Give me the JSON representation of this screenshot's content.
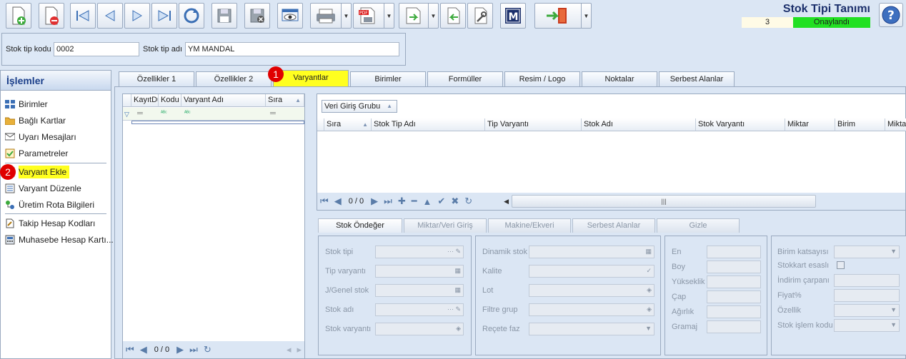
{
  "window": {
    "title": "Stok Tipi Tanımı",
    "record_number": "3",
    "status": "Onaylandı"
  },
  "header": {
    "code_label": "Stok tip kodu",
    "code_value": "0002",
    "name_label": "Stok tip adı",
    "name_value": "YM MANDAL"
  },
  "left_panel": {
    "title": "İşlemler",
    "items": [
      {
        "label": "Birimler",
        "icon": "grid-icon"
      },
      {
        "label": "Bağlı Kartlar",
        "icon": "folder-icon"
      },
      {
        "label": "Uyarı Mesajları",
        "icon": "message-icon"
      },
      {
        "label": "Parametreler",
        "icon": "checklist-icon"
      },
      {
        "label": "Varyant Ekle",
        "icon": "add-variant-icon"
      },
      {
        "label": "Varyant Düzenle",
        "icon": "edit-list-icon"
      },
      {
        "label": "Üretim Rota Bilgileri",
        "icon": "route-icon"
      },
      {
        "label": "Takip Hesap Kodları",
        "icon": "document-icon"
      },
      {
        "label": "Muhasebe Hesap Kartı...",
        "icon": "calculator-icon"
      }
    ]
  },
  "annotations": {
    "badge1": "1",
    "badge2": "2"
  },
  "tabs": [
    "Özellikler 1",
    "Özellikler 2",
    "Varyantlar",
    "Birimler",
    "Formüller",
    "Resim / Logo",
    "Noktalar",
    "Serbest Alanlar"
  ],
  "variant_grid": {
    "columns": [
      "KayıtDu",
      "Kodu",
      "Varyant Adı",
      "Sıra"
    ],
    "nav_count": "0 / 0"
  },
  "detail_grid": {
    "group_label": "Veri Giriş Grubu",
    "columns": [
      "Sıra",
      "Stok Tip Adı",
      "Tip Varyantı",
      "Stok Adı",
      "Stok Varyantı",
      "Miktar",
      "Birim",
      "Miktar"
    ],
    "nav_count": "0 / 0"
  },
  "sub_tabs": [
    "Stok Öndeğer",
    "Miktar/Veri Giriş",
    "Makine/Ekveri",
    "Serbest Alanlar",
    "Gizle"
  ],
  "group1": [
    "Stok tipi",
    "Tip varyantı",
    "J/Genel stok",
    "Stok adı",
    "Stok varyantı"
  ],
  "group2": [
    "Dinamik stok",
    "Kalite",
    "Lot",
    "Filtre grup",
    "Reçete faz"
  ],
  "group3": [
    "En",
    "Boy",
    "Yükseklik",
    "Çap",
    "Ağırlık",
    "Gramaj"
  ],
  "group4": [
    "Birim katsayısı",
    "Stokkart esaslı",
    "İndirim çarpanı",
    "Fiyat%",
    "Özellik",
    "Stok işlem kodu"
  ],
  "colors": {
    "accent_yellow": "#ffff20",
    "status_green": "#22e022",
    "badge_red": "#e00000"
  }
}
